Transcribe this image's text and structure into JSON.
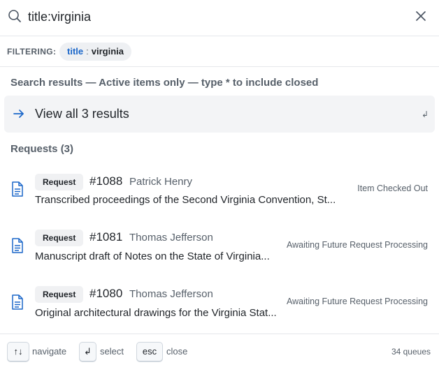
{
  "search": {
    "value": "title:virginia",
    "icon": "search-icon",
    "close_icon": "close-icon"
  },
  "filter": {
    "label": "FILTERING:",
    "chip_key": "title",
    "chip_separator": ":",
    "chip_value": "virginia"
  },
  "caption": "Search results — Active items only — type * to include closed",
  "view_all": {
    "label": "View all 3 results",
    "enter_glyph": "↲"
  },
  "group": {
    "heading": "Requests (3)"
  },
  "results": [
    {
      "type": "Request",
      "number": "#1088",
      "person": "Patrick Henry",
      "title": "Transcribed proceedings of the Second Virginia Convention, St....",
      "status": "Item Checked Out"
    },
    {
      "type": "Request",
      "number": "#1081",
      "person": "Thomas Jefferson",
      "title": "Manuscript draft of Notes on the State of Virginia...",
      "status": "Awaiting Future Request Processing"
    },
    {
      "type": "Request",
      "number": "#1080",
      "person": "Thomas Jefferson",
      "title": "Original architectural drawings for the Virginia Stat...",
      "status": "Awaiting Future Request Processing"
    }
  ],
  "footer": {
    "navigate_key": "↑↓",
    "navigate_label": "navigate",
    "select_key": "↲",
    "select_label": "select",
    "close_key": "esc",
    "close_label": "close",
    "queue_count": "34 queues"
  },
  "colors": {
    "accent": "#1a66c9",
    "muted": "#57606a",
    "text": "#1f2328",
    "panel": "#f3f4f6"
  }
}
